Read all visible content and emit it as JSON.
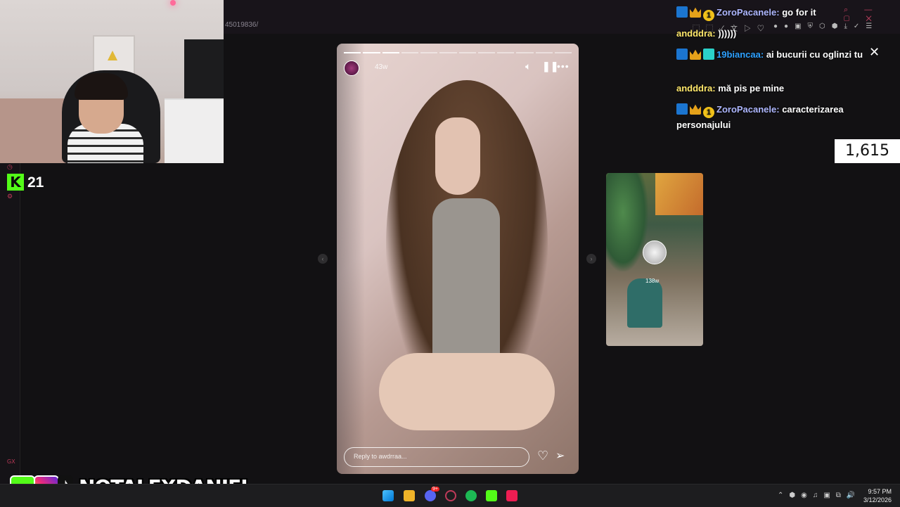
{
  "browser": {
    "url_fragment": "45019836/"
  },
  "stream": {
    "kick_follower_count": "21",
    "viewer_count": "1,615",
    "branding": {
      "name": "NOTALEXDANIEL",
      "kick_letter": "K"
    }
  },
  "story": {
    "posted_ago": "43w",
    "reply_placeholder": "Reply to awdrraa...",
    "progress_segments": 12,
    "current_segment": 3
  },
  "next_story": {
    "posted_ago": "138w"
  },
  "chat": [
    {
      "user": "ZoroPacanele:",
      "message": "go for it",
      "user_class": "u-zoro",
      "badges": [
        "b-mod",
        "b-crown",
        "b-one"
      ]
    },
    {
      "user": "andddra:",
      "message": "))))))",
      "user_class": "u-and",
      "badges": []
    },
    {
      "user": "19biancaa:",
      "message": "ai bucurii cu oglinzi tu",
      "user_class": "u-bia",
      "badges": [
        "b-mod",
        "b-crown",
        "b-grid"
      ]
    },
    {
      "user": "andddra:",
      "message": "mă pis pe mine",
      "user_class": "u-and",
      "badges": []
    },
    {
      "user": "ZoroPacanele:",
      "message": "caracterizarea personajului",
      "user_class": "u-zoro",
      "badges": [
        "b-mod",
        "b-crown",
        "b-one"
      ]
    }
  ],
  "taskbar": {
    "clock_time": "9:57 PM",
    "clock_date": "3/12/2026",
    "discord_badge": "9+",
    "icons": [
      "windows-start-icon",
      "file-explorer-icon",
      "discord-icon",
      "opera-gx-icon",
      "spotify-icon",
      "kick-icon",
      "tiktok-icon"
    ]
  },
  "icons": {
    "mute": "speaker-icon",
    "pause": "pause-icon",
    "more": "ellipsis-icon",
    "heart": "heart-icon",
    "send": "send-icon",
    "close": "close-icon"
  },
  "colors": {
    "kick_green": "#53fc18",
    "opera_red": "#c03a5a"
  }
}
